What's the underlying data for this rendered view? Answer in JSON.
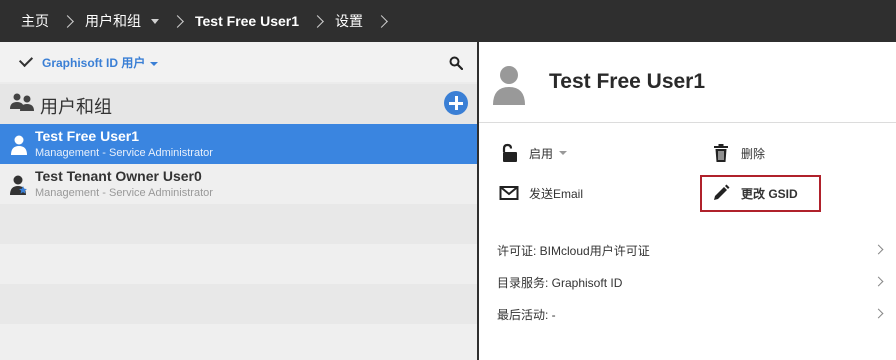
{
  "breadcrumb": {
    "home": "主页",
    "users_groups": "用户和组",
    "user": "Test Free User1",
    "settings": "设置"
  },
  "left_panel": {
    "filter_label": "Graphisoft ID 用户",
    "group_label": "用户和组",
    "users": [
      {
        "name": "Test Free User1",
        "subtitle": "Management - Service Administrator",
        "selected": true
      },
      {
        "name": "Test Tenant Owner User0",
        "subtitle": "Management - Service Administrator",
        "selected": false
      }
    ]
  },
  "detail": {
    "title": "Test Free User1",
    "actions": {
      "enable": "启用",
      "delete": "删除",
      "send_email": "发送Email",
      "change_gsid": "更改 GSID"
    },
    "info": [
      {
        "label": "许可证: BIMcloud用户许可证"
      },
      {
        "label": "目录服务: Graphisoft ID"
      },
      {
        "label": "最后活动: -"
      }
    ]
  },
  "colors": {
    "accent": "#3a85e0",
    "topbar": "#2f2f2f",
    "highlight": "#b0212b"
  }
}
